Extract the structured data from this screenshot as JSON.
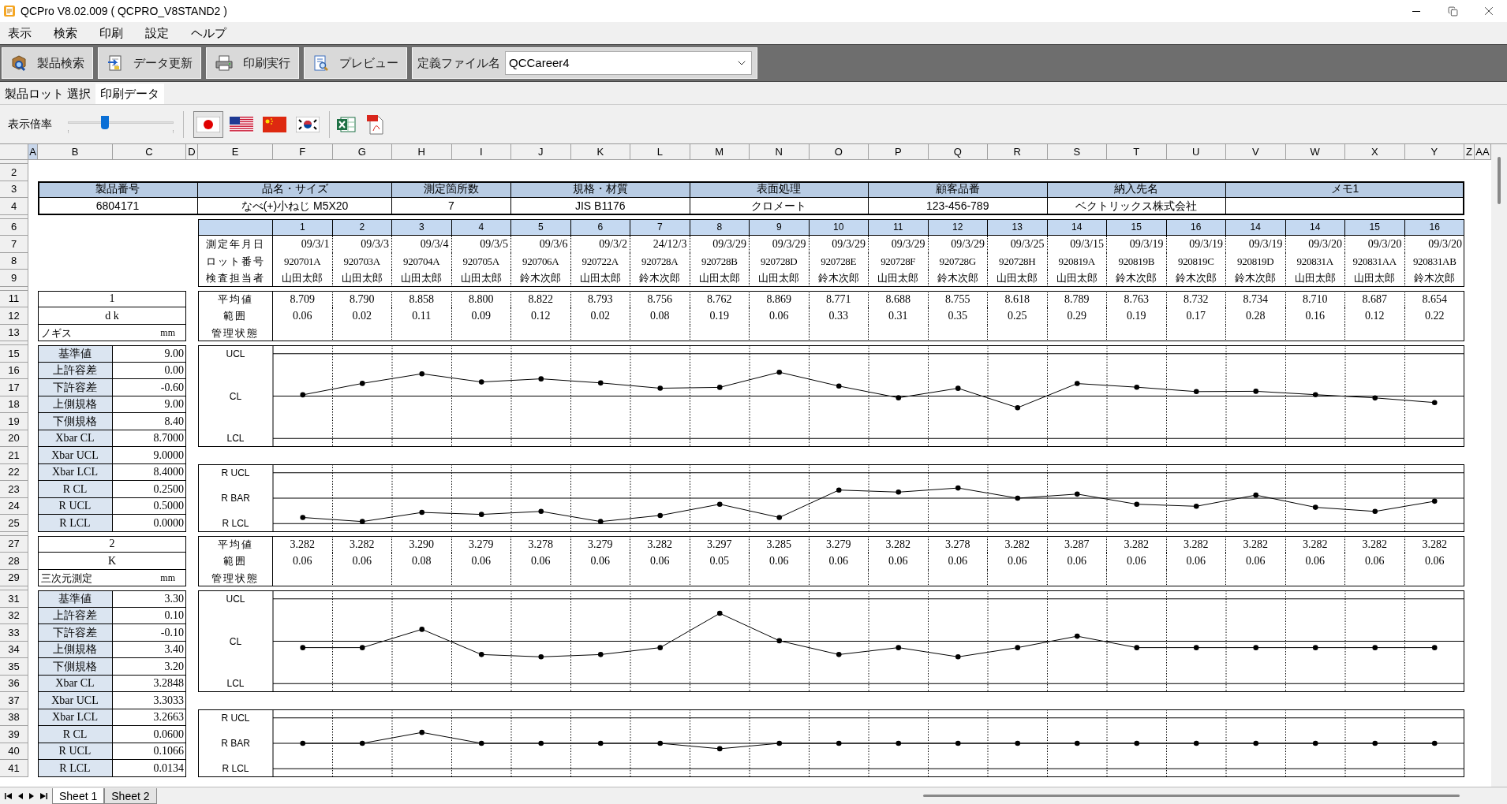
{
  "window": {
    "title": "QCPro V8.02.009 ( QCPRO_V8STAND2 )"
  },
  "menu": [
    "表示",
    "検索",
    "印刷",
    "設定",
    "ヘルプ"
  ],
  "toolbar": {
    "buttons": [
      {
        "kind": "search",
        "label": "製品検索"
      },
      {
        "kind": "refresh",
        "label": "データ更新"
      },
      {
        "kind": "print",
        "label": "印刷実行"
      },
      {
        "kind": "preview",
        "label": "プレビュー"
      }
    ],
    "definition_file": {
      "label": "定義ファイル名",
      "value": "QCCareer4"
    }
  },
  "tabs": [
    {
      "label": "製品ロット 選択",
      "selected": false
    },
    {
      "label": "印刷データ",
      "selected": true
    }
  ],
  "view_toolbar": {
    "zoom": {
      "label": "表示倍率",
      "level": 0.35
    },
    "language_buttons": [
      {
        "kind": "japan",
        "selected": true
      },
      {
        "kind": "usa",
        "selected": false
      },
      {
        "kind": "china",
        "selected": false
      },
      {
        "kind": "korea",
        "selected": false
      }
    ],
    "export_buttons": [
      {
        "kind": "spreadsheet"
      },
      {
        "kind": "pdf"
      }
    ]
  },
  "sheet": {
    "column_letters": [
      "A",
      "B",
      "C",
      "D",
      "E",
      "F",
      "G",
      "H",
      "I",
      "J",
      "K",
      "L",
      "M",
      "N",
      "O",
      "P",
      "Q",
      "R",
      "S",
      "T",
      "U",
      "V",
      "W",
      "X",
      "Y",
      "Z",
      "AA"
    ],
    "row_numbers": [
      "2",
      "3",
      "4",
      "6",
      "7",
      "8",
      "9",
      "11",
      "12",
      "13",
      "15",
      "16",
      "17",
      "18",
      "19",
      "20",
      "21",
      "22",
      "23",
      "24",
      "25",
      "27",
      "28",
      "29",
      "31",
      "32",
      "33",
      "34",
      "35",
      "36",
      "37",
      "38",
      "39",
      "40",
      "41"
    ],
    "info": [
      {
        "label": "製品番号",
        "value": "6804171"
      },
      {
        "label": "品名・サイズ",
        "value": "なべ(+)小ねじ M5X20"
      },
      {
        "label": "測定箇所数",
        "value": "7"
      },
      {
        "label": "規格・材質",
        "value": "JIS B1176"
      },
      {
        "label": "表面処理",
        "value": "クロメート"
      },
      {
        "label": "顧客品番",
        "value": "123-456-789"
      },
      {
        "label": "納入先名",
        "value": "ベクトリックス株式会社"
      },
      {
        "label": "メモ1"
      }
    ],
    "sample_labels": [
      "測定年月日",
      "ロット番号",
      "検査担当者"
    ],
    "samples": [
      {
        "no": "1",
        "date": "09/3/1",
        "lot": "920701A",
        "inspector": "山田太郎"
      },
      {
        "no": "2",
        "date": "09/3/3",
        "lot": "920703A",
        "inspector": "山田太郎"
      },
      {
        "no": "3",
        "date": "09/3/4",
        "lot": "920704A",
        "inspector": "山田太郎"
      },
      {
        "no": "4",
        "date": "09/3/5",
        "lot": "920705A",
        "inspector": "山田太郎"
      },
      {
        "no": "5",
        "date": "09/3/6",
        "lot": "920706A",
        "inspector": "鈴木次郎"
      },
      {
        "no": "6",
        "date": "09/3/2",
        "lot": "920722A",
        "inspector": "山田太郎"
      },
      {
        "no": "7",
        "date": "24/12/3",
        "lot": "920728A",
        "inspector": "鈴木次郎"
      },
      {
        "no": "8",
        "date": "09/3/29",
        "lot": "920728B",
        "inspector": "山田太郎"
      },
      {
        "no": "9",
        "date": "09/3/29",
        "lot": "920728D",
        "inspector": "山田太郎"
      },
      {
        "no": "10",
        "date": "09/3/29",
        "lot": "920728E",
        "inspector": "鈴木次郎"
      },
      {
        "no": "11",
        "date": "09/3/29",
        "lot": "920728F",
        "inspector": "山田太郎"
      },
      {
        "no": "12",
        "date": "09/3/29",
        "lot": "920728G",
        "inspector": "鈴木次郎"
      },
      {
        "no": "13",
        "date": "09/3/25",
        "lot": "920728H",
        "inspector": "山田太郎"
      },
      {
        "no": "14",
        "date": "09/3/15",
        "lot": "920819A",
        "inspector": "山田太郎"
      },
      {
        "no": "15",
        "date": "09/3/19",
        "lot": "920819B",
        "inspector": "鈴木次郎"
      },
      {
        "no": "16",
        "date": "09/3/19",
        "lot": "920819C",
        "inspector": "鈴木次郎"
      },
      {
        "no": "14",
        "date": "09/3/19",
        "lot": "920819D",
        "inspector": "鈴木次郎"
      },
      {
        "no": "14",
        "date": "09/3/20",
        "lot": "920831A",
        "inspector": "山田太郎"
      },
      {
        "no": "15",
        "date": "09/3/20",
        "lot": "920831AA",
        "inspector": "山田太郎"
      },
      {
        "no": "16",
        "date": "09/3/20",
        "lot": "920831AB",
        "inspector": "鈴木次郎"
      }
    ],
    "measures": [
      {
        "no": "1",
        "symbol": "d k",
        "instrument": "ノギス",
        "unit": "mm",
        "row_labels": [
          "平均値",
          "範囲",
          "管理状態"
        ],
        "averages": [
          "8.709",
          "8.790",
          "8.858",
          "8.800",
          "8.822",
          "8.793",
          "8.756",
          "8.762",
          "8.869",
          "8.771",
          "8.688",
          "8.755",
          "8.618",
          "8.789",
          "8.763",
          "8.732",
          "8.734",
          "8.710",
          "8.687",
          "8.654"
        ],
        "ranges": [
          "0.06",
          "0.02",
          "0.11",
          "0.09",
          "0.12",
          "0.02",
          "0.08",
          "0.19",
          "0.06",
          "0.33",
          "0.31",
          "0.35",
          "0.25",
          "0.29",
          "0.19",
          "0.17",
          "0.28",
          "0.16",
          "0.12",
          "0.22"
        ],
        "specs": [
          {
            "label": "基準値",
            "value": "9.00"
          },
          {
            "label": "上許容差",
            "value": "0.00"
          },
          {
            "label": "下許容差",
            "value": "-0.60"
          },
          {
            "label": "上側規格",
            "value": "9.00"
          },
          {
            "label": "下側規格",
            "value": "8.40"
          },
          {
            "label": "Xbar CL",
            "value": "8.7000"
          },
          {
            "label": "Xbar UCL",
            "value": "9.0000"
          },
          {
            "label": "Xbar LCL",
            "value": "8.4000"
          },
          {
            "label": "R CL",
            "value": "0.2500"
          },
          {
            "label": "R UCL",
            "value": "0.5000"
          },
          {
            "label": "R LCL",
            "value": "0.0000"
          }
        ],
        "x_chart": {
          "limit_labels": [
            "UCL",
            "CL",
            "LCL"
          ]
        },
        "r_chart": {
          "limit_labels": [
            "R UCL",
            "R BAR",
            "R LCL"
          ]
        }
      },
      {
        "no": "2",
        "symbol": "K",
        "instrument": "三次元測定",
        "unit": "mm",
        "row_labels": [
          "平均値",
          "範囲",
          "管理状態"
        ],
        "averages": [
          "3.282",
          "3.282",
          "3.290",
          "3.279",
          "3.278",
          "3.279",
          "3.282",
          "3.297",
          "3.285",
          "3.279",
          "3.282",
          "3.278",
          "3.282",
          "3.287",
          "3.282",
          "3.282",
          "3.282",
          "3.282",
          "3.282",
          "3.282"
        ],
        "ranges": [
          "0.06",
          "0.06",
          "0.08",
          "0.06",
          "0.06",
          "0.06",
          "0.06",
          "0.05",
          "0.06",
          "0.06",
          "0.06",
          "0.06",
          "0.06",
          "0.06",
          "0.06",
          "0.06",
          "0.06",
          "0.06",
          "0.06",
          "0.06"
        ],
        "specs": [
          {
            "label": "基準値",
            "value": "3.30"
          },
          {
            "label": "上許容差",
            "value": "0.10"
          },
          {
            "label": "下許容差",
            "value": "-0.10"
          },
          {
            "label": "上側規格",
            "value": "3.40"
          },
          {
            "label": "下側規格",
            "value": "3.20"
          },
          {
            "label": "Xbar CL",
            "value": "3.2848"
          },
          {
            "label": "Xbar UCL",
            "value": "3.3033"
          },
          {
            "label": "Xbar LCL",
            "value": "3.2663"
          },
          {
            "label": "R CL",
            "value": "0.0600"
          },
          {
            "label": "R UCL",
            "value": "0.1066"
          },
          {
            "label": "R LCL",
            "value": "0.0134"
          }
        ],
        "x_chart": {
          "limit_labels": [
            "UCL",
            "CL",
            "LCL"
          ]
        },
        "r_chart": {
          "limit_labels": [
            "R UCL",
            "R BAR",
            "R LCL"
          ]
        }
      }
    ]
  },
  "sheet_tabs": [
    {
      "label": "Sheet 1",
      "selected": true
    },
    {
      "label": "Sheet 2",
      "selected": false
    }
  ]
}
